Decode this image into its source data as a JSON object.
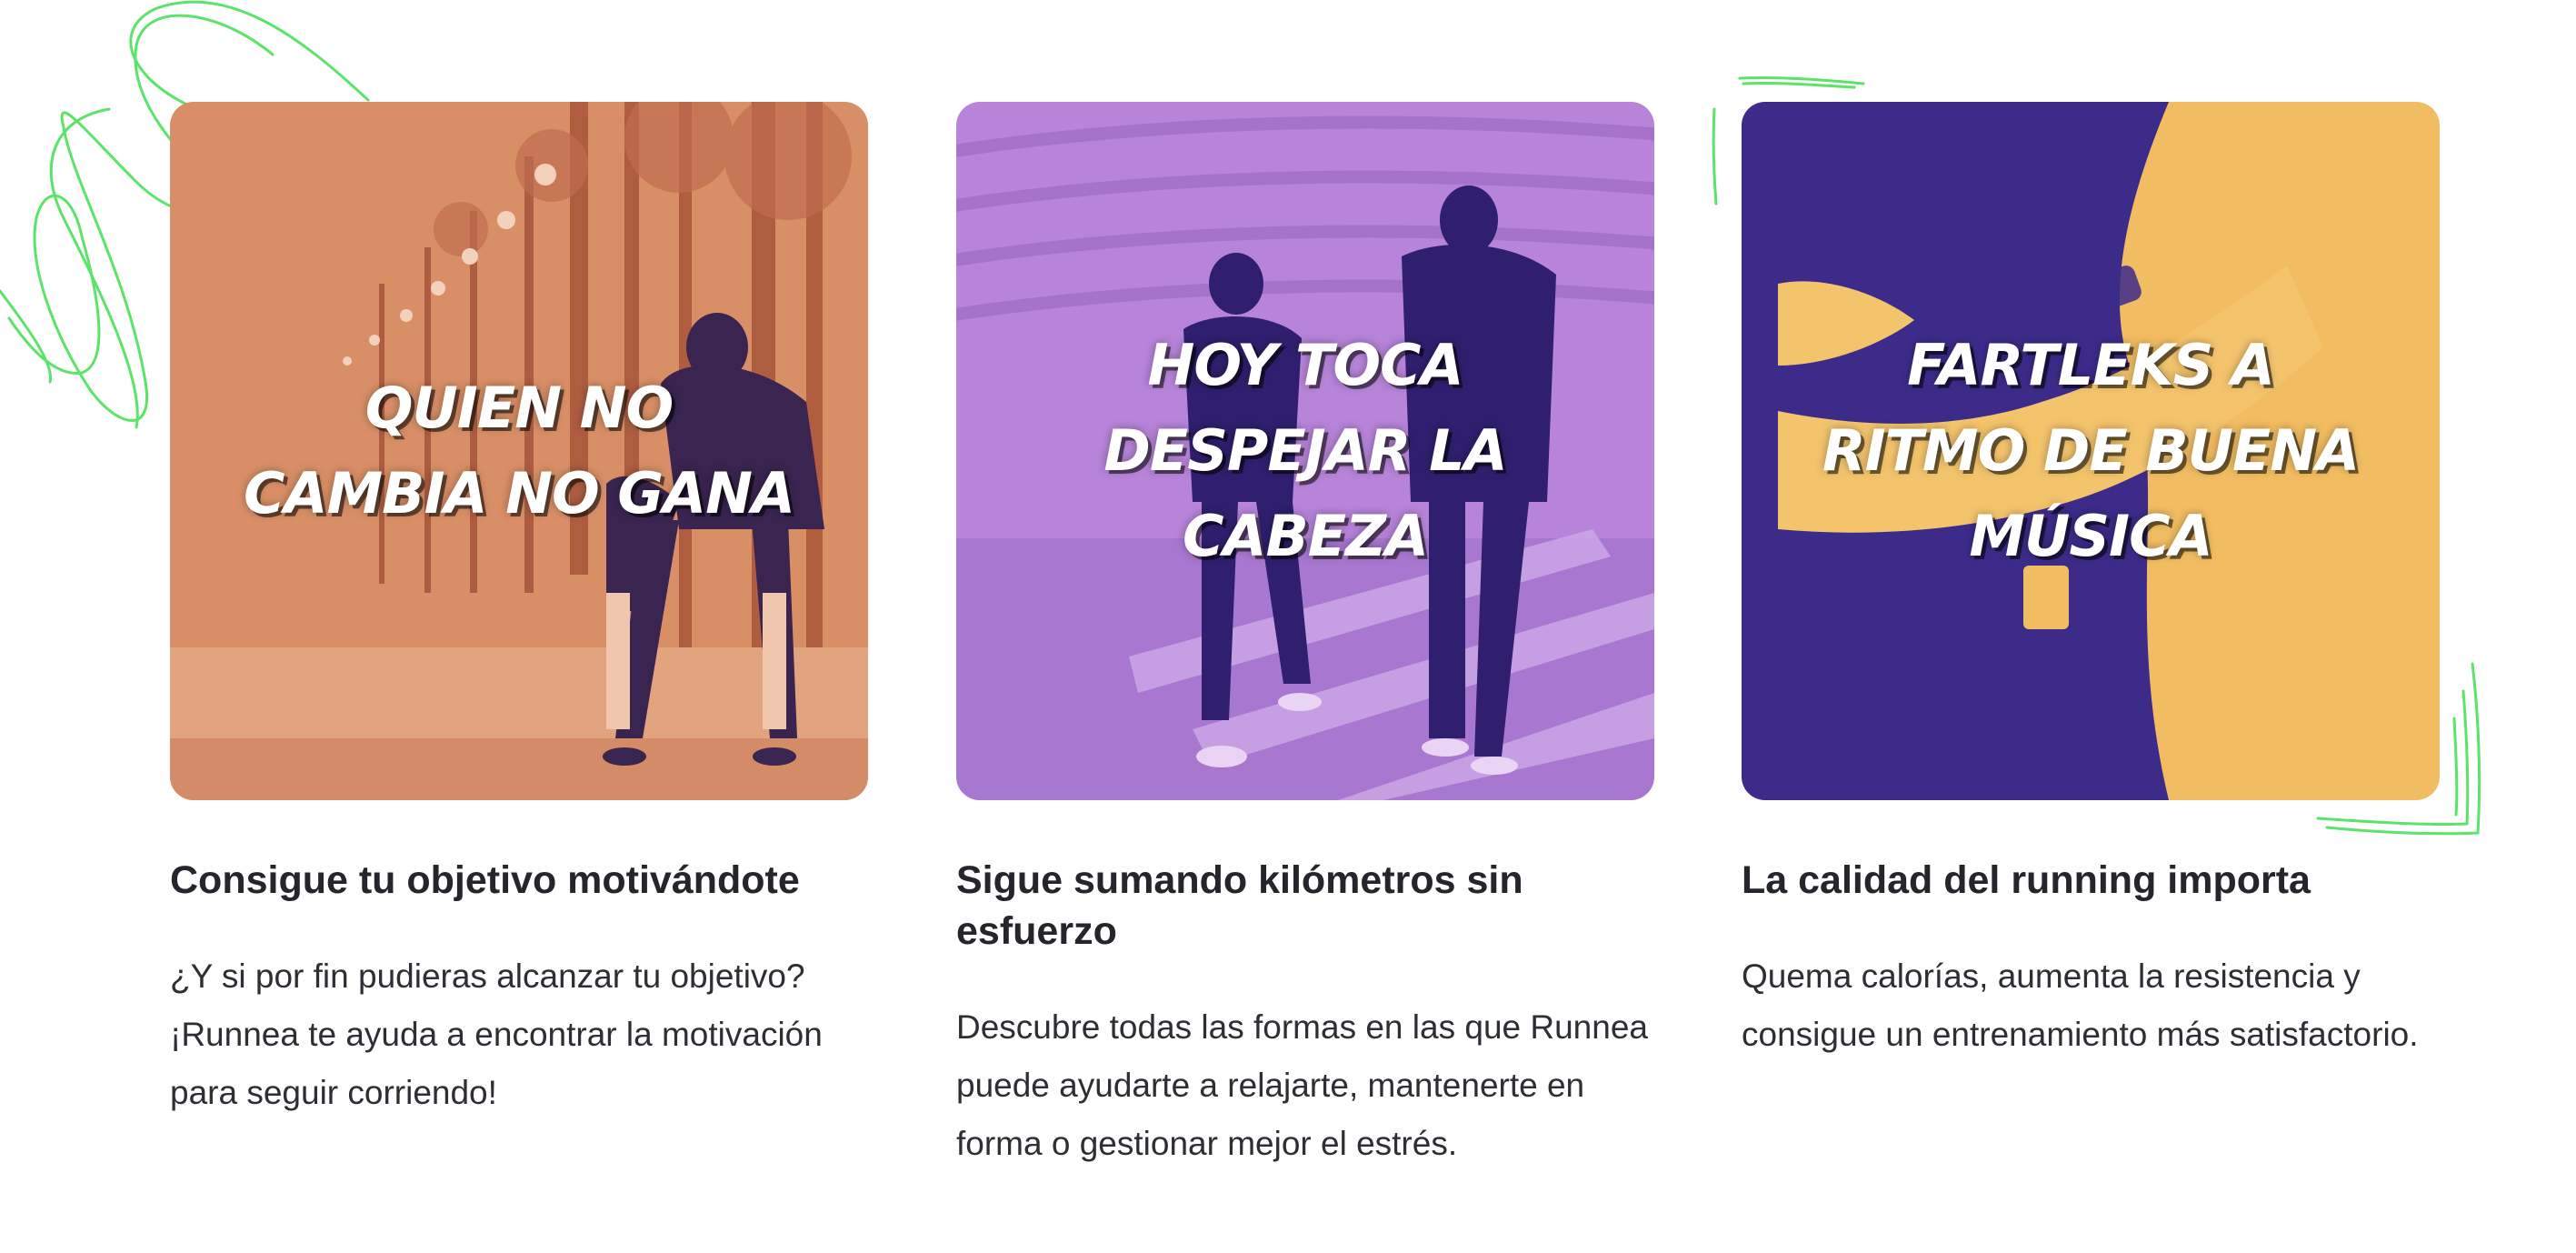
{
  "cards": [
    {
      "overlay_text": "QUIEN NO\nCAMBIA NO GANA",
      "title": "Consigue tu objetivo motivándote",
      "description": "¿Y si por fin pudieras alcanzar tu objetivo? ¡Runnea te ayuda a encontrar la motivación para seguir corriendo!",
      "image_tint": "#d98f66"
    },
    {
      "overlay_text": "HOY TOCA\nDESPEJAR LA\nCABEZA",
      "title": "Sigue sumando kilómetros sin esfuerzo",
      "description": "Descubre todas las formas en las que Runnea puede ayudarte a relajarte, mantenerte en forma o gestionar mejor el estrés.",
      "image_tint": "#b784d9"
    },
    {
      "overlay_text": "FARTLEKS A\nRITMO DE BUENA\nMÚSICA",
      "title": "La calidad del running importa",
      "description": "Quema calorías, aumenta la resistencia y consigue un entrenamiento más satisfactorio.",
      "image_tint": "#f2bd62"
    }
  ],
  "colors": {
    "accent_doodle": "#5be36a",
    "purple_dark": "#3d2b8a",
    "text": "#25252b"
  }
}
